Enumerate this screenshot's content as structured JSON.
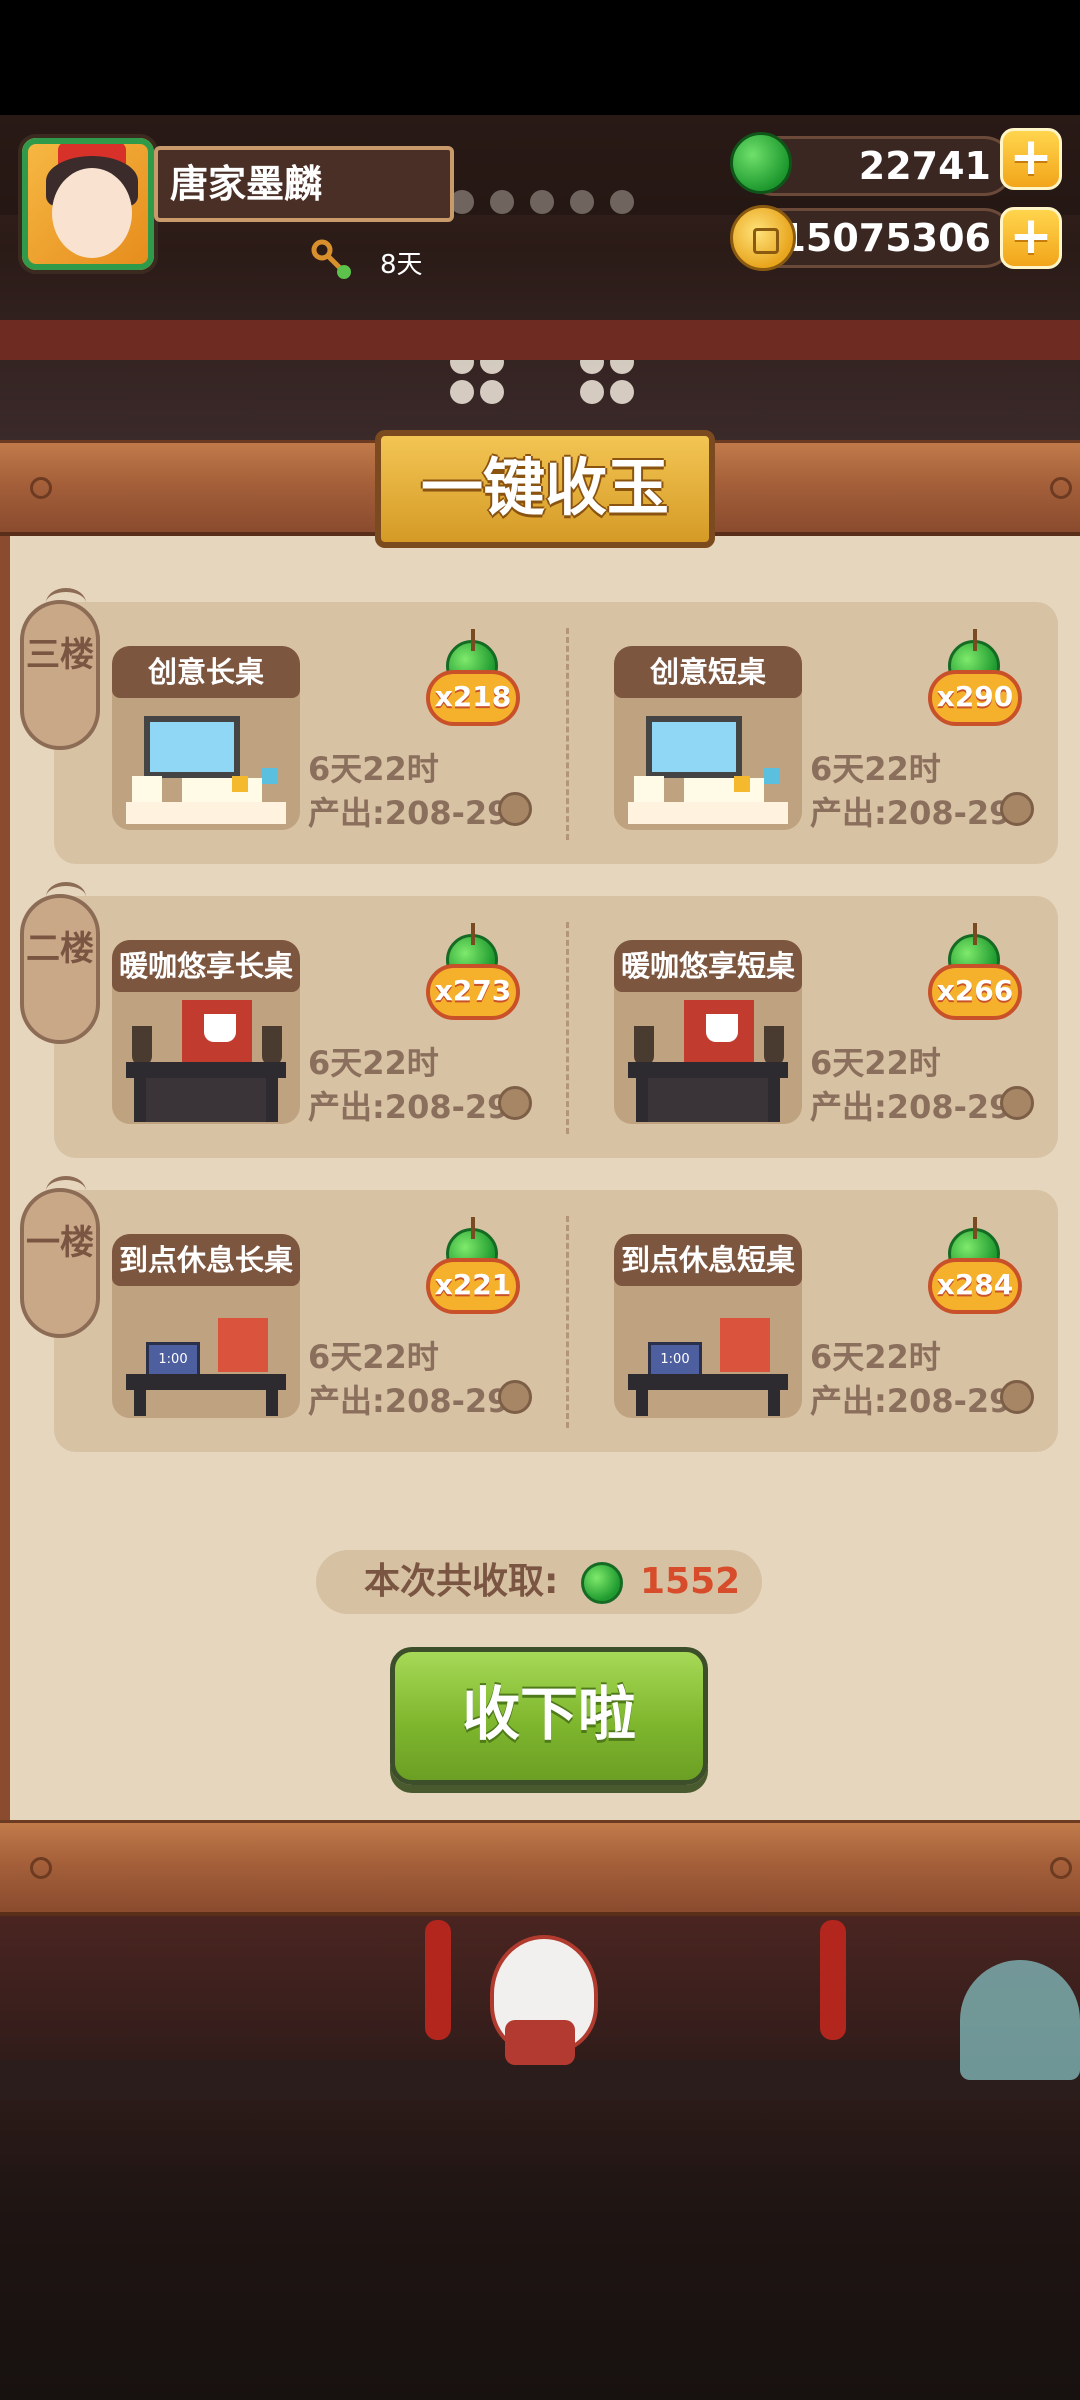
{
  "player": {
    "name": "唐家墨麟",
    "days": "8天"
  },
  "currencies": {
    "jade": "22741",
    "coins": "15075306"
  },
  "panel": {
    "title": "一键收玉",
    "floors": [
      {
        "label": "三楼",
        "tables": [
          {
            "name": "创意长桌",
            "count": "x218",
            "time": "6天22时",
            "output": "产出:208-29"
          },
          {
            "name": "创意短桌",
            "count": "x290",
            "time": "6天22时",
            "output": "产出:208-29"
          }
        ]
      },
      {
        "label": "二楼",
        "tables": [
          {
            "name": "暖咖悠享长桌",
            "count": "x273",
            "time": "6天22时",
            "output": "产出:208-29"
          },
          {
            "name": "暖咖悠享短桌",
            "count": "x266",
            "time": "6天22时",
            "output": "产出:208-29"
          }
        ]
      },
      {
        "label": "一楼",
        "tables": [
          {
            "name": "到点休息长桌",
            "count": "x221",
            "time": "6天22时",
            "output": "产出:208-29",
            "clock": "1:00"
          },
          {
            "name": "到点休息短桌",
            "count": "x284",
            "time": "6天22时",
            "output": "产出:208-29",
            "clock": "1:00"
          }
        ]
      }
    ],
    "total_label": "本次共收取:",
    "total_value": "1552",
    "confirm_label": "收下啦"
  },
  "colors": {
    "jade_green": "#1f9a2f",
    "coin_gold": "#e8a51d",
    "panel_bg": "#e6d6bd",
    "card_bg": "#d8c2a4",
    "confirm_green": "#7fb72e",
    "total_value_red": "#d74d2c",
    "badge_orange": "#f5b02c"
  },
  "icons": {
    "jade": "green-jade-icon",
    "coin": "gold-coin-icon",
    "plus": "plus-icon",
    "days": "key-icon"
  }
}
